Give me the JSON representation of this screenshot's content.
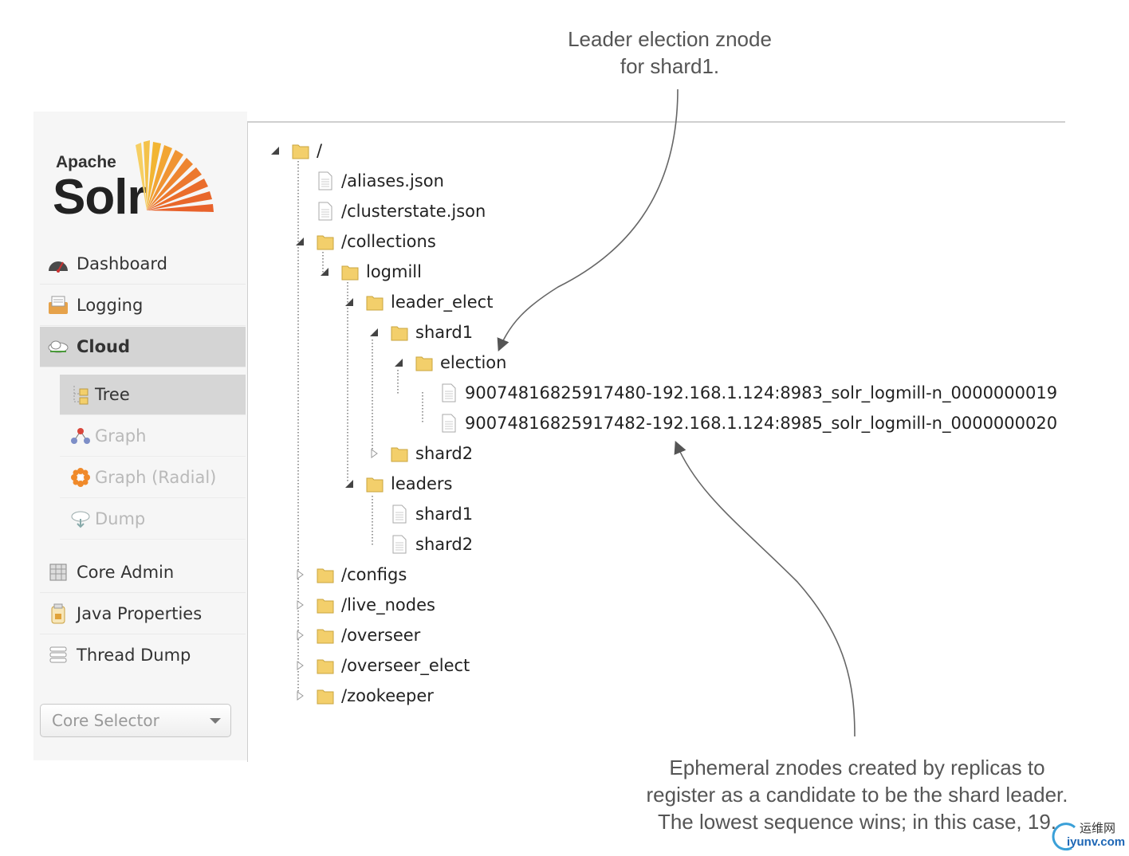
{
  "annotations": {
    "top": [
      "Leader election znode",
      "for shard1."
    ],
    "bottom": [
      "Ephemeral znodes created by replicas to",
      "register as a candidate to be the shard leader.",
      "The lowest sequence wins; in this case, 19."
    ]
  },
  "logo": {
    "line1": "Apache",
    "line2": "Solr"
  },
  "sidebar": {
    "items": [
      {
        "label": "Dashboard",
        "icon": "dashboard-gauge-icon"
      },
      {
        "label": "Logging",
        "icon": "logging-icon"
      },
      {
        "label": "Cloud",
        "icon": "cloud-icon",
        "active": true
      },
      {
        "label": "Core Admin",
        "icon": "core-admin-icon"
      },
      {
        "label": "Java Properties",
        "icon": "java-properties-icon"
      },
      {
        "label": "Thread Dump",
        "icon": "thread-dump-icon"
      }
    ],
    "cloud_subitems": [
      {
        "label": "Tree",
        "icon": "tree-icon",
        "active": true
      },
      {
        "label": "Graph",
        "icon": "graph-icon"
      },
      {
        "label": "Graph (Radial)",
        "icon": "graph-radial-icon"
      },
      {
        "label": "Dump",
        "icon": "dump-icon"
      }
    ],
    "core_selector": "Core Selector"
  },
  "tree": [
    {
      "label": "/",
      "type": "folder",
      "state": "open"
    },
    {
      "label": "/aliases.json",
      "type": "file"
    },
    {
      "label": "/clusterstate.json",
      "type": "file"
    },
    {
      "label": "/collections",
      "type": "folder",
      "state": "open"
    },
    {
      "label": "logmill",
      "type": "folder",
      "state": "open"
    },
    {
      "label": "leader_elect",
      "type": "folder",
      "state": "open"
    },
    {
      "label": "shard1",
      "type": "folder",
      "state": "open"
    },
    {
      "label": "election",
      "type": "folder",
      "state": "open"
    },
    {
      "label": "90074816825917480-192.168.1.124:8983_solr_logmill-n_0000000019",
      "type": "file"
    },
    {
      "label": "90074816825917482-192.168.1.124:8985_solr_logmill-n_0000000020",
      "type": "file"
    },
    {
      "label": "shard2",
      "type": "folder",
      "state": "closed"
    },
    {
      "label": "leaders",
      "type": "folder",
      "state": "open"
    },
    {
      "label": "shard1",
      "type": "file"
    },
    {
      "label": "shard2",
      "type": "file"
    },
    {
      "label": "/configs",
      "type": "folder",
      "state": "closed"
    },
    {
      "label": "/live_nodes",
      "type": "folder",
      "state": "closed"
    },
    {
      "label": "/overseer",
      "type": "folder",
      "state": "closed"
    },
    {
      "label": "/overseer_elect",
      "type": "folder",
      "state": "closed"
    },
    {
      "label": "/zookeeper",
      "type": "folder",
      "state": "closed"
    }
  ],
  "watermark": {
    "cn": "运维网",
    "en": "iyunv.com"
  },
  "colors": {
    "folder": "#f3cf6b",
    "sun_orange": "#e8672b",
    "sun_yellow": "#f2b533",
    "active_bg": "#d4d4d4",
    "watermark_blue": "#1d66b5"
  }
}
